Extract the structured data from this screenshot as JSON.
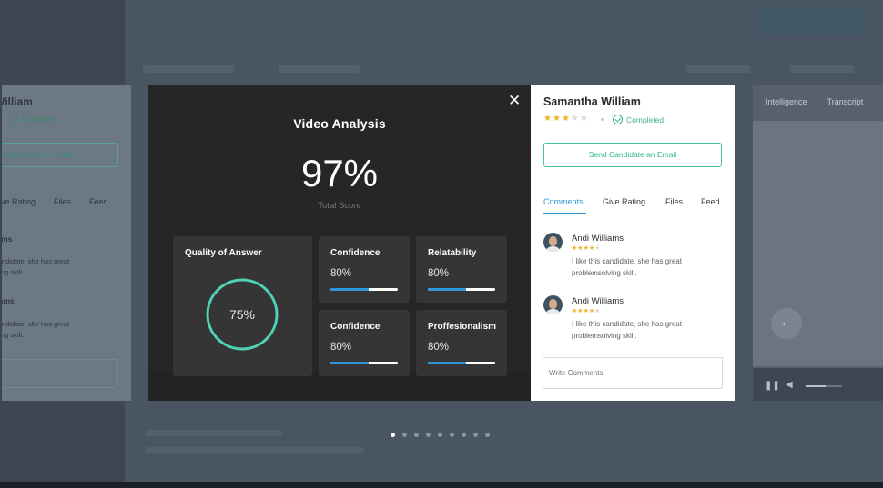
{
  "background": {
    "left_peek": {
      "name": "William",
      "status": "Completed",
      "email_button": "Candidate an Email",
      "tabs": [
        "ive Rating",
        "Files",
        "Feed"
      ],
      "comments": [
        {
          "name": "iams",
          "text_line1": "candidate, she has great",
          "text_line2": "lving skill."
        },
        {
          "name": "liams",
          "text_line1": "candidate, she has great",
          "text_line2": "lving skill."
        }
      ]
    },
    "right_peek": {
      "tabs": [
        "Intelligence",
        "Transcript"
      ],
      "back_icon": "arrow-left-icon",
      "pause_icon": "pause-icon",
      "volume_icon": "volume-icon"
    }
  },
  "video_analysis": {
    "close_icon": "close-icon",
    "close_glyph": "✕",
    "title": "Video Analysis",
    "total_score": "97%",
    "total_score_label": "Total Score",
    "quality_of_answer": {
      "title": "Quality of Answer",
      "value_text": "75%",
      "value": 0.75
    },
    "metrics": [
      {
        "title": "Confidence",
        "value_text": "80%",
        "value": 0.57
      },
      {
        "title": "Relatability",
        "value_text": "80%",
        "value": 0.57
      },
      {
        "title": "Confidence",
        "value_text": "80%",
        "value": 0.57
      },
      {
        "title": "Proffesionalism",
        "value_text": "80%",
        "value": 0.57
      }
    ]
  },
  "candidate": {
    "name": "Samantha William",
    "rating": 3,
    "rating_max": 5,
    "status": "Completed",
    "email_button": "Send Candidate an Email",
    "tabs": [
      "Comments",
      "Give Rating",
      "Files",
      "Feed"
    ],
    "active_tab": "Comments",
    "comments": [
      {
        "author": "Andi Williams",
        "rating": 4,
        "text": "I like this candidate, she has great problemsolving skill."
      },
      {
        "author": "Andi Williams",
        "rating": 4,
        "text": "I like this candidate, she has great problemsolving skill."
      }
    ],
    "comment_placeholder": "Write Comments"
  },
  "pagination": {
    "count": 9,
    "active_index": 0
  },
  "colors": {
    "accent_blue": "#2f97d8",
    "accent_green": "#3bb38a",
    "star": "#f2b324",
    "ring": "#4fd1b5"
  }
}
